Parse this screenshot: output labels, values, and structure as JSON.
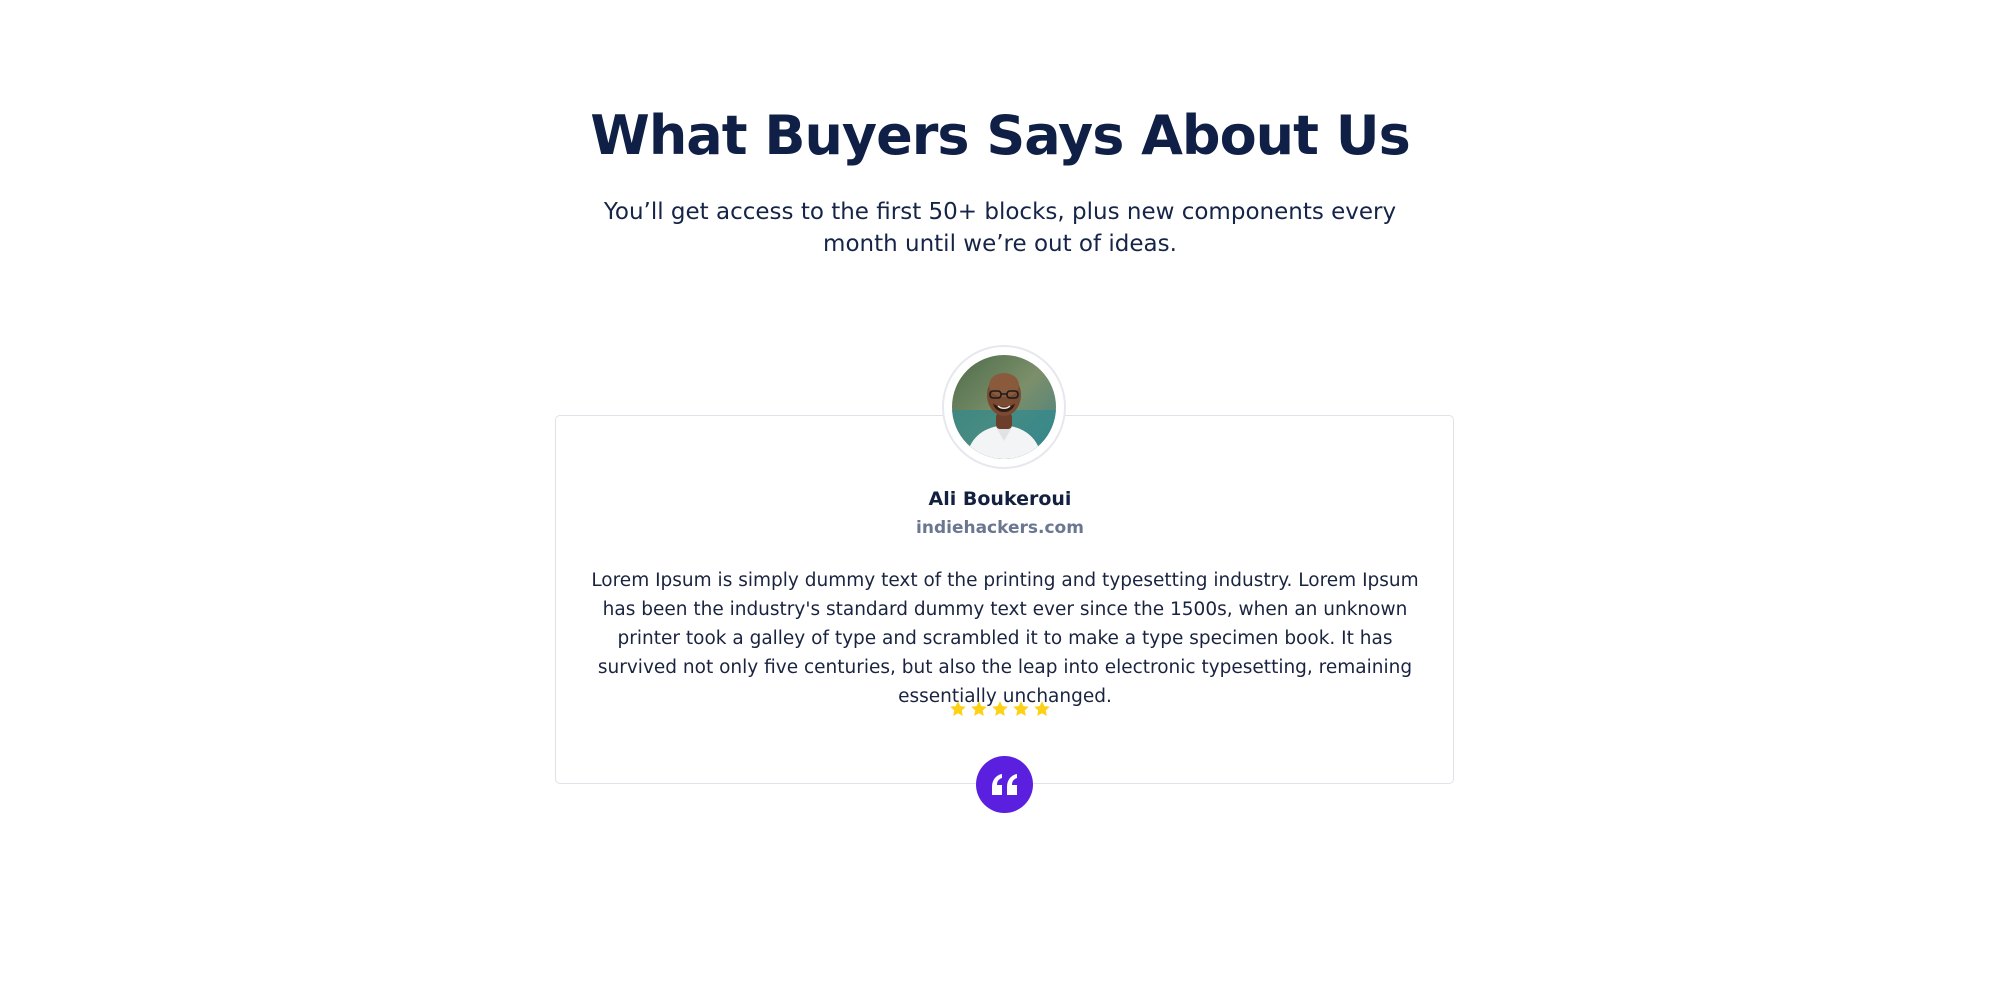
{
  "header": {
    "title": "What Buyers Says About Us",
    "subtitle": "You’ll get access to the first 50+ blocks, plus new components every month until we’re out of ideas."
  },
  "testimonial": {
    "name": "Ali Boukeroui",
    "website": "indiehackers.com",
    "text": "Lorem Ipsum is simply dummy text of the printing and typesetting industry. Lorem Ipsum has been the industry's standard dummy text ever since the 1500s, when an unknown printer took a galley of type and scrambled it to make a type specimen book. It has survived not only five centuries, but also the leap into electronic typesetting, remaining essentially unchanged.",
    "rating": 5,
    "rating_max": 5,
    "avatar_icon": "person-photo",
    "quote_icon": "quote-icon"
  },
  "colors": {
    "heading": "#0f1f46",
    "star": "#fcd116",
    "accent": "#5b1fe0",
    "muted": "#6b7690",
    "card_border": "#dfe2e8"
  }
}
